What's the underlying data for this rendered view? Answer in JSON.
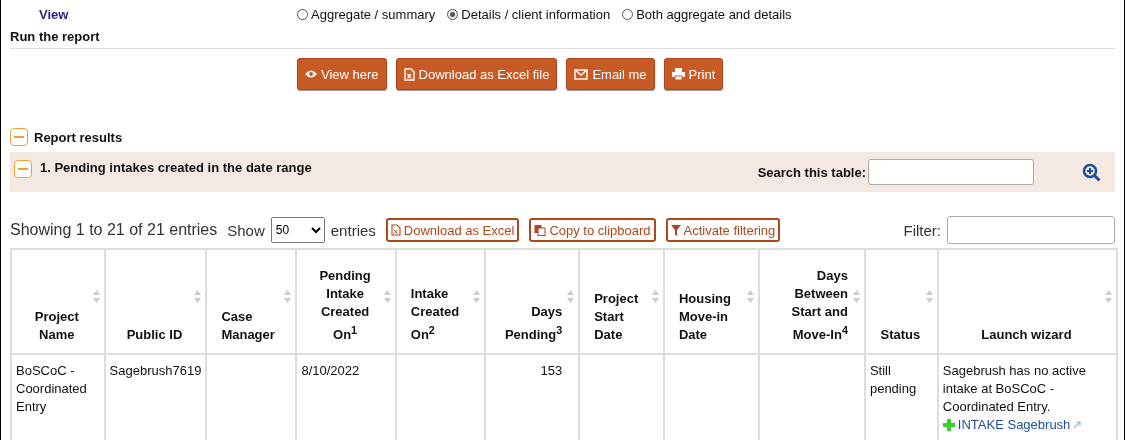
{
  "view": {
    "label": "View",
    "options": [
      {
        "label": "Aggregate / summary",
        "selected": false
      },
      {
        "label": "Details / client information",
        "selected": true
      },
      {
        "label": "Both aggregate and details",
        "selected": false
      }
    ]
  },
  "run_section": {
    "title": "Run the report",
    "buttons": [
      {
        "label": "View here",
        "kind": "eye"
      },
      {
        "label": "Download as Excel file",
        "kind": "excel"
      },
      {
        "label": "Email me",
        "kind": "email"
      },
      {
        "label": "Print",
        "kind": "print"
      }
    ]
  },
  "report": {
    "title": "Report results",
    "expanded": true
  },
  "section": {
    "title": "1. Pending intakes created in the date range",
    "expanded": true,
    "search_label": "Search this table:"
  },
  "table_controls": {
    "info": "Showing 1 to 21 of 21 entries",
    "show_label": "Show",
    "page_size": "50",
    "entries_label": "entries",
    "buttons": [
      {
        "label": "Download as Excel",
        "kind": "excel"
      },
      {
        "label": "Copy to clipboard",
        "kind": "copy"
      },
      {
        "label": "Activate filtering",
        "kind": "filter"
      }
    ],
    "filter_label": "Filter:"
  },
  "table": {
    "columns": [
      {
        "label": "Project Name"
      },
      {
        "label": "Public ID"
      },
      {
        "label": "Case Manager"
      },
      {
        "label": "Pending Intake Created On$^{1}$"
      },
      {
        "label": "Intake Created On$^{2}$"
      },
      {
        "label": "Days Pending$^{3}$"
      },
      {
        "label": "Project Start Date"
      },
      {
        "label": "Housing Move-in Date"
      },
      {
        "label": "Days Between Start and Move-In$^{4}$"
      },
      {
        "label": "Status"
      },
      {
        "label": "Launch wizard"
      }
    ],
    "rows": [
      {
        "cells": [
          "BoSCoC - Coordinated Entry",
          "Sagebrush7619",
          "",
          "8/10/2022",
          "",
          "153",
          "",
          "",
          "",
          "Still pending"
        ],
        "wizard": {
          "message": "Sagebrush has no active intake at BoSCoC - Coordinated Entry.",
          "link": "INTAKE Sagebrush"
        }
      }
    ]
  }
}
